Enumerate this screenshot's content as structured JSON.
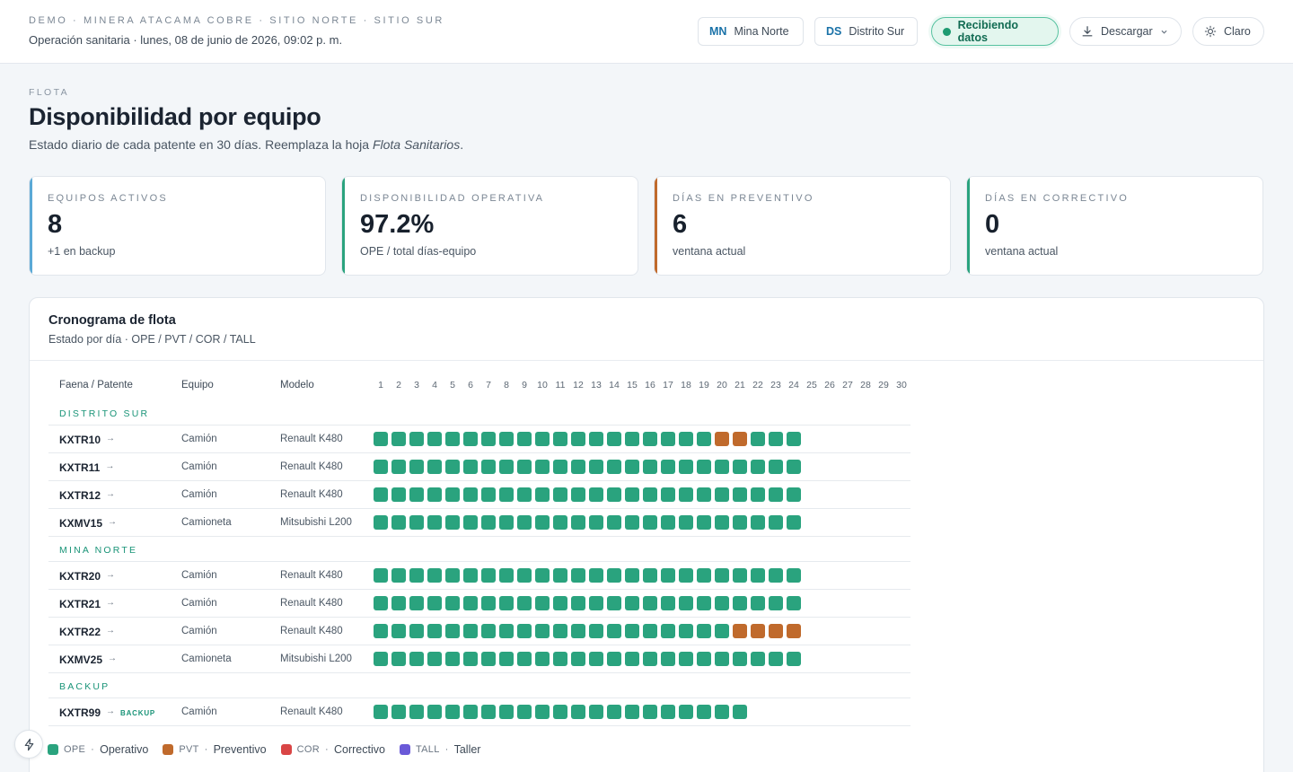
{
  "header": {
    "org_line": "DEMO · MINERA ATACAMA COBRE · SITIO NORTE · SITIO SUR",
    "subtitle": "Operación sanitaria · lunes, 08 de junio de 2026, 09:02 p. m.",
    "sites": [
      {
        "code": "MN",
        "label": "Mina Norte"
      },
      {
        "code": "DS",
        "label": "Distrito Sur"
      }
    ],
    "live_label": "Recibiendo datos",
    "download_label": "Descargar",
    "theme_label": "Claro"
  },
  "page": {
    "eyebrow": "FLOTA",
    "title": "Disponibilidad por equipo",
    "desc_prefix": "Estado diario de cada patente en 30 días. Reemplaza la hoja ",
    "desc_em": "Flota Sanitarios",
    "desc_suffix": "."
  },
  "kpis": [
    {
      "label": "EQUIPOS ACTIVOS",
      "value": "8",
      "note": "+1 en backup",
      "accent": "#5aa9d6"
    },
    {
      "label": "DISPONIBILIDAD OPERATIVA",
      "value": "97.2%",
      "note": "OPE / total días-equipo",
      "accent": "#2aa37e"
    },
    {
      "label": "DÍAS EN PREVENTIVO",
      "value": "6",
      "note": "ventana actual",
      "accent": "#c06a2c"
    },
    {
      "label": "DÍAS EN CORRECTIVO",
      "value": "0",
      "note": "ventana actual",
      "accent": "#2aa37e"
    }
  ],
  "schedule": {
    "title": "Cronograma de flota",
    "subtitle": "Estado por día · OPE / PVT / COR / TALL",
    "columns": {
      "plate": "Faena / Patente",
      "type": "Equipo",
      "model": "Modelo"
    },
    "days": [
      "1",
      "2",
      "3",
      "4",
      "5",
      "6",
      "7",
      "8",
      "9",
      "10",
      "11",
      "12",
      "13",
      "14",
      "15",
      "16",
      "17",
      "18",
      "19",
      "20",
      "21",
      "22",
      "23",
      "24",
      "25",
      "26",
      "27",
      "28",
      "29",
      "30"
    ],
    "status_colors": {
      "OPE": "#2aa37e",
      "PVT": "#c06a2c",
      "COR": "#d94545",
      "TALL": "#6a5ad8"
    },
    "groups": [
      {
        "name": "DISTRITO SUR",
        "rows": [
          {
            "plate": "KXTR10",
            "type": "Camión",
            "model": "Renault K480",
            "badge": "",
            "states": [
              "OPE",
              "OPE",
              "OPE",
              "OPE",
              "OPE",
              "OPE",
              "OPE",
              "OPE",
              "OPE",
              "OPE",
              "OPE",
              "OPE",
              "OPE",
              "OPE",
              "OPE",
              "OPE",
              "OPE",
              "OPE",
              "OPE",
              "PVT",
              "PVT",
              "OPE",
              "OPE",
              "OPE"
            ]
          },
          {
            "plate": "KXTR11",
            "type": "Camión",
            "model": "Renault K480",
            "badge": "",
            "states": [
              "OPE",
              "OPE",
              "OPE",
              "OPE",
              "OPE",
              "OPE",
              "OPE",
              "OPE",
              "OPE",
              "OPE",
              "OPE",
              "OPE",
              "OPE",
              "OPE",
              "OPE",
              "OPE",
              "OPE",
              "OPE",
              "OPE",
              "OPE",
              "OPE",
              "OPE",
              "OPE",
              "OPE"
            ]
          },
          {
            "plate": "KXTR12",
            "type": "Camión",
            "model": "Renault K480",
            "badge": "",
            "states": [
              "OPE",
              "OPE",
              "OPE",
              "OPE",
              "OPE",
              "OPE",
              "OPE",
              "OPE",
              "OPE",
              "OPE",
              "OPE",
              "OPE",
              "OPE",
              "OPE",
              "OPE",
              "OPE",
              "OPE",
              "OPE",
              "OPE",
              "OPE",
              "OPE",
              "OPE",
              "OPE",
              "OPE"
            ]
          },
          {
            "plate": "KXMV15",
            "type": "Camioneta",
            "model": "Mitsubishi L200",
            "badge": "",
            "states": [
              "OPE",
              "OPE",
              "OPE",
              "OPE",
              "OPE",
              "OPE",
              "OPE",
              "OPE",
              "OPE",
              "OPE",
              "OPE",
              "OPE",
              "OPE",
              "OPE",
              "OPE",
              "OPE",
              "OPE",
              "OPE",
              "OPE",
              "OPE",
              "OPE",
              "OPE",
              "OPE",
              "OPE"
            ]
          }
        ]
      },
      {
        "name": "MINA NORTE",
        "rows": [
          {
            "plate": "KXTR20",
            "type": "Camión",
            "model": "Renault K480",
            "badge": "",
            "states": [
              "OPE",
              "OPE",
              "OPE",
              "OPE",
              "OPE",
              "OPE",
              "OPE",
              "OPE",
              "OPE",
              "OPE",
              "OPE",
              "OPE",
              "OPE",
              "OPE",
              "OPE",
              "OPE",
              "OPE",
              "OPE",
              "OPE",
              "OPE",
              "OPE",
              "OPE",
              "OPE",
              "OPE"
            ]
          },
          {
            "plate": "KXTR21",
            "type": "Camión",
            "model": "Renault K480",
            "badge": "",
            "states": [
              "OPE",
              "OPE",
              "OPE",
              "OPE",
              "OPE",
              "OPE",
              "OPE",
              "OPE",
              "OPE",
              "OPE",
              "OPE",
              "OPE",
              "OPE",
              "OPE",
              "OPE",
              "OPE",
              "OPE",
              "OPE",
              "OPE",
              "OPE",
              "OPE",
              "OPE",
              "OPE",
              "OPE"
            ]
          },
          {
            "plate": "KXTR22",
            "type": "Camión",
            "model": "Renault K480",
            "badge": "",
            "states": [
              "OPE",
              "OPE",
              "OPE",
              "OPE",
              "OPE",
              "OPE",
              "OPE",
              "OPE",
              "OPE",
              "OPE",
              "OPE",
              "OPE",
              "OPE",
              "OPE",
              "OPE",
              "OPE",
              "OPE",
              "OPE",
              "OPE",
              "OPE",
              "PVT",
              "PVT",
              "PVT",
              "PVT"
            ]
          },
          {
            "plate": "KXMV25",
            "type": "Camioneta",
            "model": "Mitsubishi L200",
            "badge": "",
            "states": [
              "OPE",
              "OPE",
              "OPE",
              "OPE",
              "OPE",
              "OPE",
              "OPE",
              "OPE",
              "OPE",
              "OPE",
              "OPE",
              "OPE",
              "OPE",
              "OPE",
              "OPE",
              "OPE",
              "OPE",
              "OPE",
              "OPE",
              "OPE",
              "OPE",
              "OPE",
              "OPE",
              "OPE"
            ]
          }
        ]
      },
      {
        "name": "BACKUP",
        "rows": [
          {
            "plate": "KXTR99",
            "type": "Camión",
            "model": "Renault K480",
            "badge": "BACKUP",
            "states": [
              "OPE",
              "OPE",
              "OPE",
              "OPE",
              "OPE",
              "OPE",
              "OPE",
              "OPE",
              "OPE",
              "OPE",
              "OPE",
              "OPE",
              "OPE",
              "OPE",
              "OPE",
              "OPE",
              "OPE",
              "OPE",
              "OPE",
              "OPE",
              "OPE"
            ]
          }
        ]
      }
    ]
  },
  "legend": [
    {
      "code": "OPE",
      "label": "Operativo",
      "status": "OPE"
    },
    {
      "code": "PVT",
      "label": "Preventivo",
      "status": "PVT"
    },
    {
      "code": "COR",
      "label": "Correctivo",
      "status": "COR"
    },
    {
      "code": "TALL",
      "label": "Taller",
      "status": "TALL"
    }
  ]
}
